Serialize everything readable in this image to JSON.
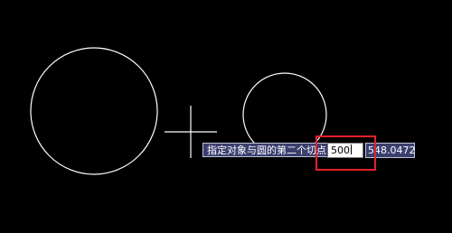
{
  "prompt": {
    "text": "指定对象与圆的第二个切点:"
  },
  "input": {
    "value": "500"
  },
  "coordinate": {
    "text": "548.0472"
  },
  "colors": {
    "background": "#000000",
    "geometry": "#ffffff",
    "tooltip_bg": "#3a3f6e",
    "highlight": "#e2202b"
  },
  "icons": {
    "cursor": "crosshair-icon"
  }
}
